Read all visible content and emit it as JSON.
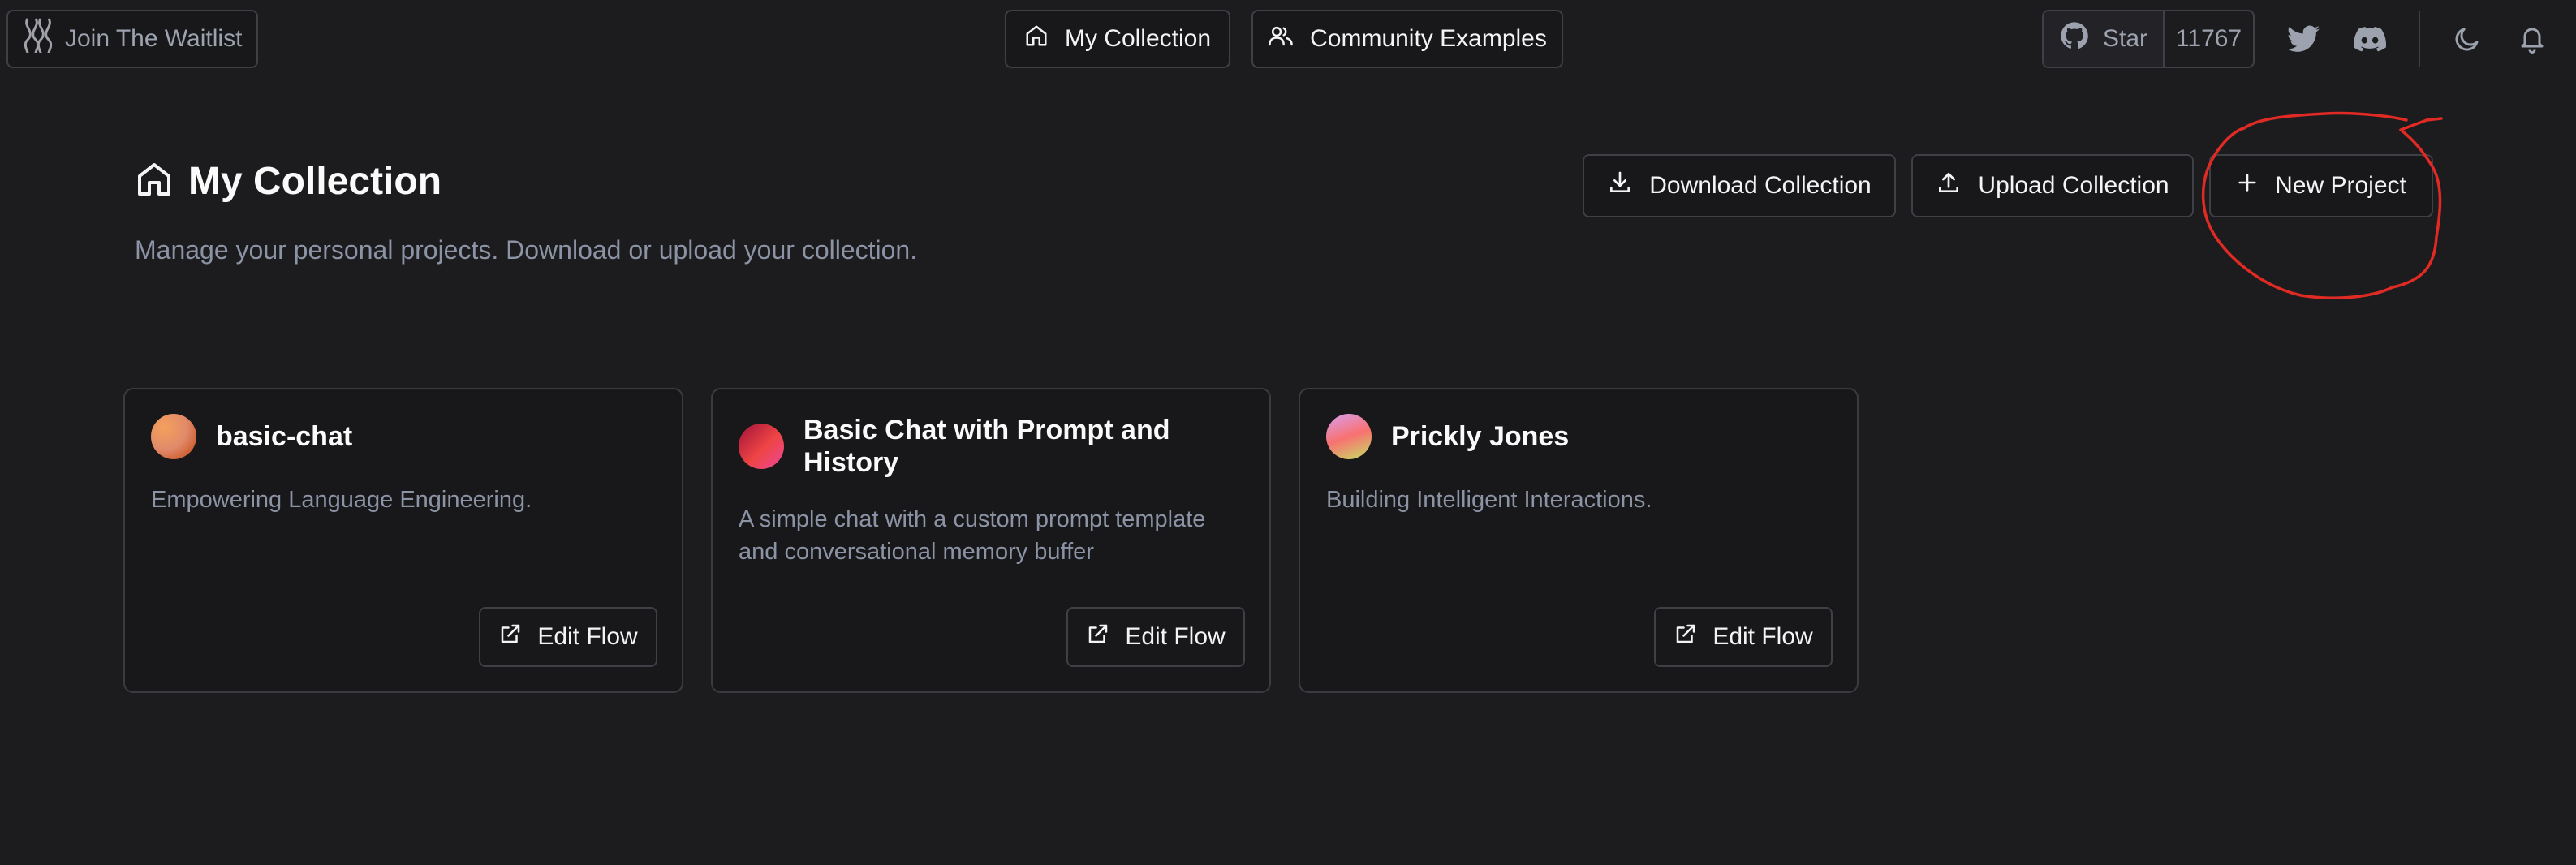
{
  "topbar": {
    "waitlist_label": "Join The Waitlist",
    "nav": [
      {
        "label": "My Collection",
        "icon": "home-icon"
      },
      {
        "label": "Community Examples",
        "icon": "users-icon"
      }
    ],
    "github": {
      "star_label": "Star",
      "star_count": "11767"
    },
    "icons": [
      "twitter-icon",
      "discord-icon",
      "moon-icon",
      "bell-icon"
    ]
  },
  "header": {
    "title": "My Collection",
    "subtitle": "Manage your personal projects. Download or upload your collection.",
    "actions": {
      "download": "Download Collection",
      "upload": "Upload Collection",
      "new_project": "New Project"
    }
  },
  "cards": [
    {
      "title": "basic-chat",
      "description": "Empowering Language Engineering.",
      "button": "Edit Flow"
    },
    {
      "title": "Basic Chat with Prompt and History",
      "description": "A simple chat with a custom prompt template and conversational memory buffer",
      "button": "Edit Flow"
    },
    {
      "title": "Prickly Jones",
      "description": "Building Intelligent Interactions.",
      "button": "Edit Flow"
    }
  ],
  "colors": {
    "background": "#1c1c1f",
    "border": "#3f3f46",
    "muted_text": "#8b93a4",
    "annotation_red": "#e02a24",
    "avatar_gradients": [
      [
        "#f59e0b",
        "#f0997a",
        "#c2410c"
      ],
      [
        "#be123c",
        "#ef4444",
        "#ec4899"
      ],
      [
        "#f0abfc",
        "#f87171",
        "#a3e635"
      ]
    ]
  }
}
